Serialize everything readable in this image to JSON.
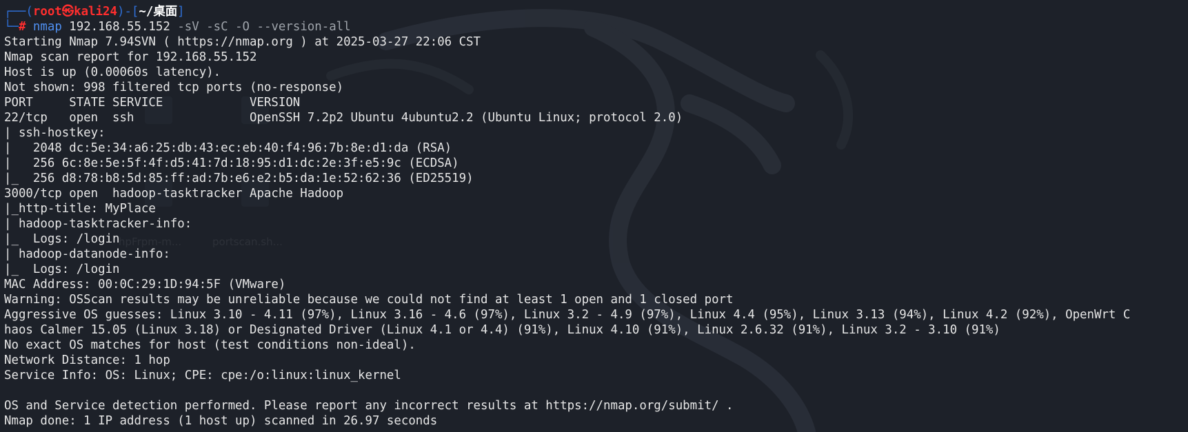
{
  "theme": {
    "background": "#1d2129",
    "text": "#e6e6e6",
    "prompt_frame": "#2f6fd6",
    "prompt_user": "#ff2e2e",
    "command": "#4f8ff0",
    "args": "#9fa4ab"
  },
  "prompt": {
    "frame_top": "┌──(",
    "user_host": "root㉿kali24",
    "frame_mid": ")-[",
    "path": "~/桌面",
    "frame_end": "]",
    "frame_bottom": "└─",
    "hash": "# "
  },
  "command": {
    "name": "nmap",
    "target": " 192.168.55.152",
    "args": " -sV -sC -O --version-all"
  },
  "output": [
    "Starting Nmap 7.94SVN ( https://nmap.org ) at 2025-03-27 22:06 CST",
    "Nmap scan report for 192.168.55.152",
    "Host is up (0.00060s latency).",
    "Not shown: 998 filtered tcp ports (no-response)",
    "PORT     STATE SERVICE            VERSION",
    "22/tcp   open  ssh                OpenSSH 7.2p2 Ubuntu 4ubuntu2.2 (Ubuntu Linux; protocol 2.0)",
    "| ssh-hostkey: ",
    "|   2048 dc:5e:34:a6:25:db:43:ec:eb:40:f4:96:7b:8e:d1:da (RSA)",
    "|   256 6c:8e:5e:5f:4f:d5:41:7d:18:95:d1:dc:2e:3f:e5:9c (ECDSA)",
    "|_  256 d8:78:b8:5d:85:ff:ad:7b:e6:e2:b5:da:1e:52:62:36 (ED25519)",
    "3000/tcp open  hadoop-tasktracker Apache Hadoop",
    "|_http-title: MyPlace",
    "| hadoop-tasktracker-info: ",
    "|_  Logs: /login",
    "| hadoop-datanode-info: ",
    "|_  Logs: /login",
    "MAC Address: 00:0C:29:1D:94:5F (VMware)",
    "Warning: OSScan results may be unreliable because we could not find at least 1 open and 1 closed port",
    "Aggressive OS guesses: Linux 3.10 - 4.11 (97%), Linux 3.16 - 4.6 (97%), Linux 3.2 - 4.9 (97%), Linux 4.4 (95%), Linux 3.13 (94%), Linux 4.2 (92%), OpenWrt C",
    "haos Calmer 15.05 (Linux 3.18) or Designated Driver (Linux 4.1 or 4.4) (91%), Linux 4.10 (91%), Linux 2.6.32 (91%), Linux 3.2 - 3.10 (91%)",
    "No exact OS matches for host (test conditions non-ideal).",
    "Network Distance: 1 hop",
    "Service Info: OS: Linux; CPE: cpe:/o:linux:linux_kernel",
    "",
    "OS and Service detection performed. Please report any incorrect results at https://nmap.org/submit/ .",
    "Nmap done: 1 IP address (1 host up) scanned in 26.97 seconds"
  ],
  "background_ghost_labels": [
    "hpFrpm-m...",
    "portscan.sh..."
  ]
}
